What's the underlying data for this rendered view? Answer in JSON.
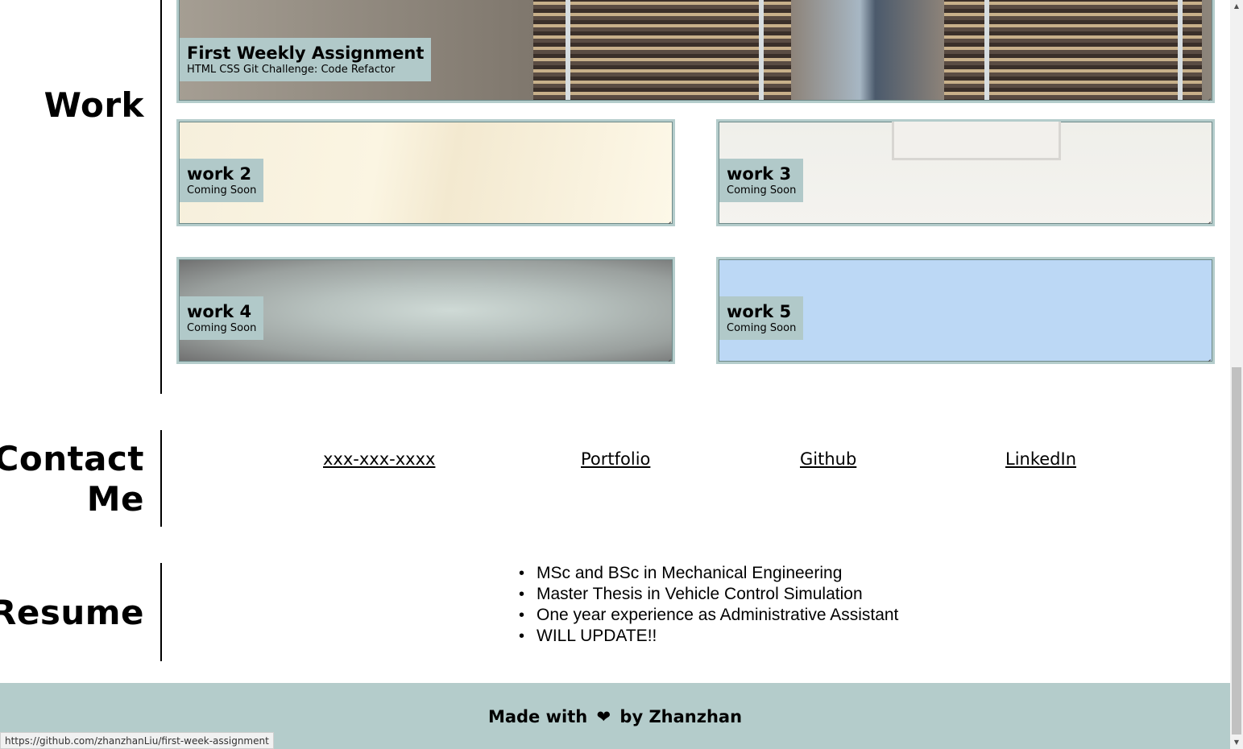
{
  "work": {
    "title": "Work",
    "cards": [
      {
        "title": "First Weekly Assignment",
        "subtitle": "HTML CSS Git Challenge: Code Refactor"
      },
      {
        "title": "work 2",
        "subtitle": "Coming Soon"
      },
      {
        "title": "work 3",
        "subtitle": "Coming Soon"
      },
      {
        "title": "work 4",
        "subtitle": "Coming Soon"
      },
      {
        "title": "work 5",
        "subtitle": "Coming Soon"
      }
    ]
  },
  "contact": {
    "title_line1": "Contact",
    "title_line2": "Me",
    "links": [
      "xxx-xxx-xxxx",
      "Portfolio",
      "Github",
      "LinkedIn"
    ]
  },
  "resume": {
    "title": "Resume",
    "items": [
      "MSc and BSc in Mechanical Engineering",
      "Master Thesis in Vehicle Control Simulation",
      "One year experience as Administrative Assistant",
      "WILL UPDATE!!"
    ]
  },
  "footer": {
    "prefix": "Made with",
    "heart": "❤",
    "suffix": "by Zhanzhan"
  },
  "status_bar": {
    "url": "https://github.com/zhanzhanLiu/first-week-assignment"
  },
  "colors": {
    "accent": "#b4cccb",
    "label_bg": "#b1c9c9",
    "work5_bg": "#bcd8f5"
  },
  "icons": {
    "footer": "heart-icon",
    "scroll_up": "arrow-up-icon",
    "scroll_down": "arrow-down-icon"
  }
}
